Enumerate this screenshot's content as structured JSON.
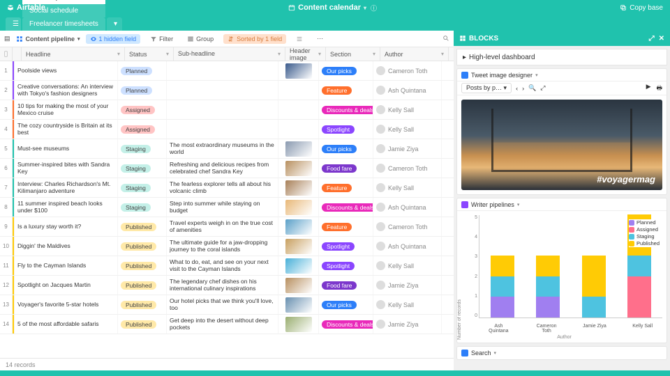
{
  "topbar": {
    "brand": "Airtable",
    "title": "Content calendar",
    "copy": "Copy base"
  },
  "tabs": [
    {
      "label": "Content production",
      "active": true
    },
    {
      "label": "Social schedule",
      "active": false
    },
    {
      "label": "Freelancer timesheets",
      "active": false
    }
  ],
  "toolbar": {
    "view_name": "Content pipeline",
    "hidden_fields": "1 hidden field",
    "filter": "Filter",
    "group": "Group",
    "sort": "Sorted by 1 field"
  },
  "columns": [
    "Headline",
    "Status",
    "Sub-headline",
    "Header image",
    "Section",
    "Author"
  ],
  "status_colors": {
    "Planned": "#cde0ff",
    "Assigned": "#ffc4c4",
    "Staging": "#c4f0e8",
    "Published": "#ffe9a8"
  },
  "section_colors": {
    "Our picks": "#2d7ff9",
    "Feature": "#ff6f2c",
    "Discounts & deals": "#e929ba",
    "Spotlight": "#8b46ff",
    "Food fare": "#7c37cc"
  },
  "stripe_colors": [
    "#8b46ff",
    "#8b46ff",
    "#ff6f2c",
    "#ff6f2c",
    "#20c2ad",
    "#20c2ad",
    "#20c2ad",
    "#20c2ad",
    "#ffcb05",
    "#ffcb05",
    "#ffcb05",
    "#ffcb05",
    "#ffcb05",
    "#ffcb05"
  ],
  "thumbs": [
    "#3a5a8c",
    "",
    "",
    "",
    "#8a9ab0",
    "#b89060",
    "#a88058",
    "#e8b878",
    "#5aa0c8",
    "#c8a060",
    "#48b0d8",
    "#b89060",
    "#6890b0",
    "#9aae70"
  ],
  "rows": [
    {
      "n": 1,
      "headline": "Poolside views",
      "status": "Planned",
      "sub": "",
      "section": "Our picks",
      "author": "Cameron Toth"
    },
    {
      "n": 2,
      "headline": "Creative conversations: An interview with Tokyo's fashion designers",
      "status": "Planned",
      "sub": "",
      "section": "Feature",
      "author": "Ash Quintana"
    },
    {
      "n": 3,
      "headline": "10 tips for making the most of your Mexico cruise",
      "status": "Assigned",
      "sub": "",
      "section": "Discounts & deals",
      "author": "Kelly Sall"
    },
    {
      "n": 4,
      "headline": "The cozy countryside is Britain at its best",
      "status": "Assigned",
      "sub": "",
      "section": "Spotlight",
      "author": "Kelly Sall"
    },
    {
      "n": 5,
      "headline": "Must-see museums",
      "status": "Staging",
      "sub": "The most extraordinary museums in the world",
      "section": "Our picks",
      "author": "Jamie Ziya"
    },
    {
      "n": 6,
      "headline": "Summer-inspired bites with Sandra Key",
      "status": "Staging",
      "sub": "Refreshing and delicious recipes from celebrated chef Sandra Key",
      "section": "Food fare",
      "author": "Cameron Toth"
    },
    {
      "n": 7,
      "headline": "Interview: Charles Richardson's Mt. Kilimanjaro adventure",
      "status": "Staging",
      "sub": "The fearless explorer tells all about his volcanic climb",
      "section": "Feature",
      "author": "Kelly Sall"
    },
    {
      "n": 8,
      "headline": "11 summer inspired beach looks under $100",
      "status": "Staging",
      "sub": "Step into summer while staying on budget",
      "section": "Discounts & deals",
      "author": "Ash Quintana"
    },
    {
      "n": 9,
      "headline": "Is a luxury stay worth it?",
      "status": "Published",
      "sub": "Travel experts weigh in on the true cost of amenities",
      "section": "Feature",
      "author": "Cameron Toth"
    },
    {
      "n": 10,
      "headline": "Diggin' the Maldives",
      "status": "Published",
      "sub": "The ultimate guide for a jaw-dropping journey to the coral islands",
      "section": "Spotlight",
      "author": "Ash Quintana"
    },
    {
      "n": 11,
      "headline": "Fly to the Cayman Islands",
      "status": "Published",
      "sub": "What to do, eat, and see on your next visit to the Cayman Islands",
      "section": "Spotlight",
      "author": "Kelly Sall"
    },
    {
      "n": 12,
      "headline": "Spotlight on Jacques Martin",
      "status": "Published",
      "sub": "The legendary chef dishes on his international culinary inspirations",
      "section": "Food fare",
      "author": "Jamie Ziya"
    },
    {
      "n": 13,
      "headline": "Voyager's favorite 5-star hotels",
      "status": "Published",
      "sub": "Our hotel picks that we think you'll love, too",
      "section": "Our picks",
      "author": "Kelly Sall"
    },
    {
      "n": 14,
      "headline": "5 of the most affordable safaris",
      "status": "Published",
      "sub": "Get deep into the desert without deep pockets",
      "section": "Discounts & deals",
      "author": "Jamie Ziya"
    }
  ],
  "footer": {
    "count": "14 records"
  },
  "blocks": {
    "header": "BLOCKS",
    "dashboard": "High-level dashboard",
    "b1": {
      "title": "Tweet image designer",
      "dropdown": "Posts by p…",
      "caption": "#voyagermag"
    },
    "b2": {
      "title": "Writer pipelines",
      "ylabel": "Number of records",
      "xlabel": "Author"
    },
    "b3": {
      "title": "Search"
    }
  },
  "chart_data": {
    "type": "bar",
    "stacked": true,
    "categories": [
      "Ash Quintana",
      "Cameron Toth",
      "Jamie Ziya",
      "Kelly Sall"
    ],
    "series": [
      {
        "name": "Planned",
        "color": "#a07ff0",
        "values": [
          1,
          1,
          0,
          0
        ]
      },
      {
        "name": "Assigned",
        "color": "#ff6f8b",
        "values": [
          0,
          0,
          0,
          2
        ]
      },
      {
        "name": "Staging",
        "color": "#4ec3e0",
        "values": [
          1,
          1,
          1,
          1
        ]
      },
      {
        "name": "Published",
        "color": "#ffcb05",
        "values": [
          1,
          1,
          2,
          2
        ]
      }
    ],
    "ylabel": "Number of records",
    "xlabel": "Author",
    "ylim": [
      0,
      5
    ],
    "yticks": [
      0,
      1,
      2,
      3,
      4,
      5
    ],
    "legend_position": "right"
  }
}
